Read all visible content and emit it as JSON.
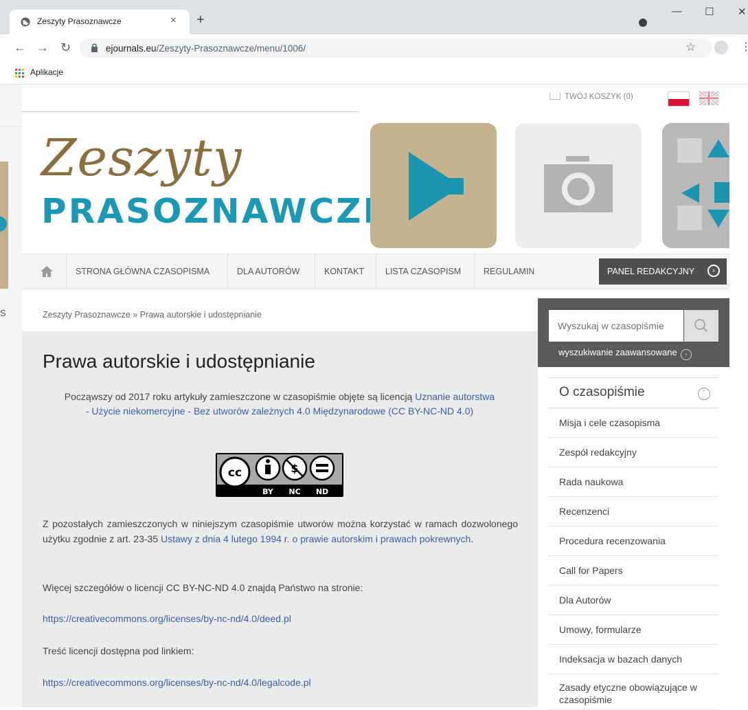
{
  "browser": {
    "tab_title": "Zeszyty Prasoznawcze",
    "tab_close": "×",
    "new_tab": "+",
    "url_host": "ejournals.eu",
    "url_path": "/Zeszyty-Prasoznawcze/menu/1006/",
    "bookmark_apps": "Aplikacje"
  },
  "header": {
    "cart": "TWÓJ KOSZYK (0)",
    "logo_script": "Zeszyty",
    "logo_block": "PRASOZNAWCZE"
  },
  "menu": {
    "items": [
      "STRONA GŁÓWNA CZASOPISMA",
      "DLA AUTORÓW",
      "KONTAKT",
      "LISTA CZASOPISM",
      "REGULAMIN"
    ],
    "panel": "PANEL REDAKCYJNY"
  },
  "breadcrumb": "Zeszyty Prasoznawcze » Prawa autorskie i udostępnianie",
  "content": {
    "title": "Prawa autorskie i udostępnianie",
    "license_intro": "Począwszy od 2017 roku artykuły zamieszczone w czasopiśmie objęte są licencją",
    "license_link": "Uznanie autorstwa - Użycie niekomercyjne - Bez utworów zależnych 4.0 Międzynarodowe (CC BY-NC-ND 4.0)",
    "cc_badge": [
      "BY",
      "NC",
      "ND"
    ],
    "p1_text": "Z pozostałych zamieszczonych w niniejszym czasopiśmie utworów można korzystać w ramach dozwolonego użytku zgodnie z art. 23-35",
    "p1_link": "Ustawy z dnia 4 lutego 1994 r. o prawie autorskim i prawach pokrewnych",
    "p2": "Więcej szczegółów o licencji CC BY-NC-ND 4.0 znajdą Państwo na stronie:",
    "link_deed": "https://creativecommons.org/licenses/by-nc-nd/4.0/deed.pl",
    "p3": "Treść licencji dostępna pod linkiem:",
    "link_legal": "https://creativecommons.org/licenses/by-nc-nd/4.0/legalcode.pl"
  },
  "sidebar": {
    "search_placeholder": "Wyszukaj w czasopiśmie",
    "advanced": "wyszukiwanie zaawansowane",
    "section_title": "O czasopiśmie",
    "items": [
      "Misja i cele czasopisma",
      "Zespół redakcyjny",
      "Rada naukowa",
      "Recenzenci",
      "Procedura recenzowania",
      "Call for Papers",
      "Dla Autorów",
      "Umowy, formularze",
      "Indeksacja w bazach danych",
      "Zasady etyczne obowiązujące w czasopiśmie"
    ]
  },
  "colors": {
    "accent": "#1a98b4",
    "gold": "#8a6f3e",
    "link": "#3a5ea8"
  }
}
